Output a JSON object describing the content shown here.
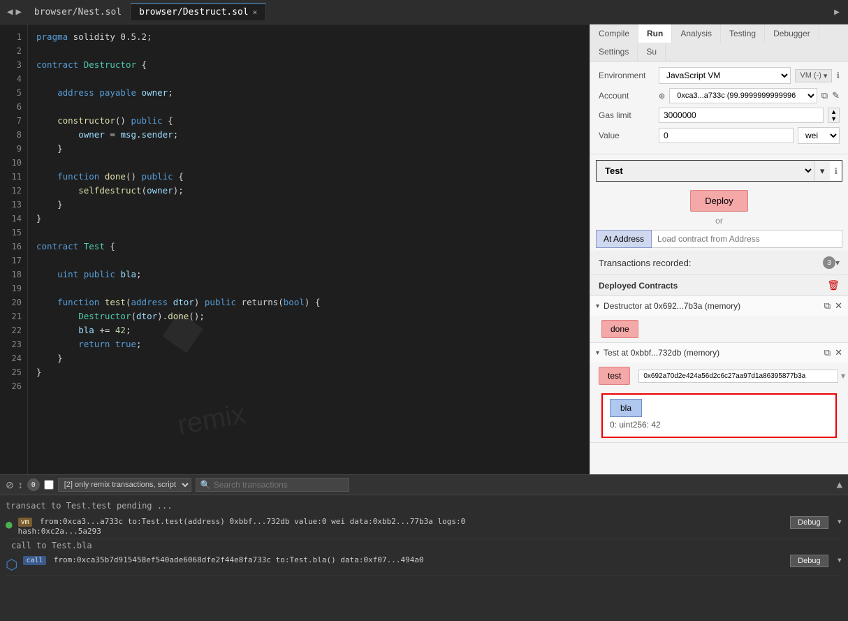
{
  "tabs": [
    {
      "id": "nest",
      "label": "browser/Nest.sol",
      "active": false,
      "closable": false
    },
    {
      "id": "destruct",
      "label": "browser/Destruct.sol",
      "active": true,
      "closable": true
    }
  ],
  "rightPanel": {
    "tabs": [
      "Compile",
      "Run",
      "Analysis",
      "Testing",
      "Debugger",
      "Settings",
      "Su"
    ],
    "activeTab": "Run",
    "environment": {
      "label": "Environment",
      "value": "JavaScript VM",
      "vmBadge": "VM (-)"
    },
    "account": {
      "label": "Account",
      "value": "0xca3...a733c (99.9999999999996"
    },
    "gasLimit": {
      "label": "Gas limit",
      "value": "3000000"
    },
    "value": {
      "label": "Value",
      "amount": "0",
      "unit": "wei"
    },
    "contractSelect": "Test",
    "deployBtn": "Deploy",
    "orText": "or",
    "atAddressBtn": "At Address",
    "atAddressPlaceholder": "Load contract from Address",
    "transactionsRecorded": "Transactions recorded:",
    "transactionsBadge": "3",
    "deployedContracts": "Deployed Contracts",
    "contracts": [
      {
        "id": "destructor",
        "name": "Destructor at 0x692...7b3a (memory)",
        "buttons": [
          "done"
        ]
      },
      {
        "id": "test",
        "name": "Test at 0xbbf...732db (memory)",
        "buttons": [
          "test"
        ],
        "testInput": "0x692a70d2e424a56d2c6c27aa97d1a86395877b3a",
        "extraButtons": [
          "bla"
        ],
        "blaResult": "0: uint256: 42"
      }
    ]
  },
  "code": {
    "lines": [
      {
        "num": 1,
        "text": "pragma solidity 0.5.2;",
        "tokens": [
          {
            "t": "kw",
            "v": "pragma"
          },
          {
            "t": "op",
            "v": " solidity 0.5.2;"
          }
        ]
      },
      {
        "num": 2,
        "text": ""
      },
      {
        "num": 3,
        "text": "contract Destructor {",
        "tokens": [
          {
            "t": "kw",
            "v": "contract"
          },
          {
            "t": "op",
            "v": " "
          },
          {
            "t": "kw2",
            "v": "Destructor"
          },
          {
            "t": "op",
            "v": " {"
          }
        ]
      },
      {
        "num": 4,
        "text": ""
      },
      {
        "num": 5,
        "text": "    address payable owner;",
        "tokens": [
          {
            "t": "kw",
            "v": "    address"
          },
          {
            "t": "op",
            "v": " "
          },
          {
            "t": "kw",
            "v": "payable"
          },
          {
            "t": "op",
            "v": " "
          },
          {
            "t": "param",
            "v": "owner"
          },
          {
            "t": "op",
            "v": ";"
          }
        ]
      },
      {
        "num": 6,
        "text": ""
      },
      {
        "num": 7,
        "text": "    constructor() public {",
        "tokens": [
          {
            "t": "op",
            "v": "    "
          },
          {
            "t": "fn",
            "v": "constructor"
          },
          {
            "t": "op",
            "v": "() "
          },
          {
            "t": "kw",
            "v": "public"
          },
          {
            "t": "op",
            "v": " {"
          }
        ]
      },
      {
        "num": 8,
        "text": "        owner = msg.sender;",
        "tokens": [
          {
            "t": "op",
            "v": "        "
          },
          {
            "t": "param",
            "v": "owner"
          },
          {
            "t": "op",
            "v": " = "
          },
          {
            "t": "param",
            "v": "msg"
          },
          {
            "t": "op",
            "v": "."
          },
          {
            "t": "param",
            "v": "sender"
          },
          {
            "t": "op",
            "v": ";"
          }
        ]
      },
      {
        "num": 9,
        "text": "    }",
        "tokens": [
          {
            "t": "op",
            "v": "    }"
          }
        ]
      },
      {
        "num": 10,
        "text": ""
      },
      {
        "num": 11,
        "text": "    function done() public {",
        "tokens": [
          {
            "t": "op",
            "v": "    "
          },
          {
            "t": "kw",
            "v": "function"
          },
          {
            "t": "op",
            "v": " "
          },
          {
            "t": "fn",
            "v": "done"
          },
          {
            "t": "op",
            "v": "() "
          },
          {
            "t": "kw",
            "v": "public"
          },
          {
            "t": "op",
            "v": " {"
          }
        ]
      },
      {
        "num": 12,
        "text": "        selfdestruct(owner);",
        "tokens": [
          {
            "t": "op",
            "v": "        "
          },
          {
            "t": "fn",
            "v": "selfdestruct"
          },
          {
            "t": "op",
            "v": "("
          },
          {
            "t": "param",
            "v": "owner"
          },
          {
            "t": "op",
            "v": ");"
          }
        ]
      },
      {
        "num": 13,
        "text": "    }",
        "tokens": [
          {
            "t": "op",
            "v": "    }"
          }
        ]
      },
      {
        "num": 14,
        "text": "}"
      },
      {
        "num": 15,
        "text": ""
      },
      {
        "num": 16,
        "text": "contract Test {",
        "tokens": [
          {
            "t": "kw",
            "v": "contract"
          },
          {
            "t": "op",
            "v": " "
          },
          {
            "t": "kw2",
            "v": "Test"
          },
          {
            "t": "op",
            "v": " {"
          }
        ]
      },
      {
        "num": 17,
        "text": ""
      },
      {
        "num": 18,
        "text": "    uint public bla;",
        "tokens": [
          {
            "t": "kw",
            "v": "    uint"
          },
          {
            "t": "op",
            "v": " "
          },
          {
            "t": "kw",
            "v": "public"
          },
          {
            "t": "op",
            "v": " "
          },
          {
            "t": "param",
            "v": "bla"
          },
          {
            "t": "op",
            "v": ";"
          }
        ]
      },
      {
        "num": 19,
        "text": ""
      },
      {
        "num": 20,
        "text": "    function test(address dtor) public returns(bool) {",
        "tokens": [
          {
            "t": "op",
            "v": "    "
          },
          {
            "t": "kw",
            "v": "function"
          },
          {
            "t": "op",
            "v": " "
          },
          {
            "t": "fn",
            "v": "test"
          },
          {
            "t": "op",
            "v": "("
          },
          {
            "t": "kw",
            "v": "address"
          },
          {
            "t": "op",
            "v": " "
          },
          {
            "t": "param",
            "v": "dtor"
          },
          {
            "t": "op",
            "v": ") "
          },
          {
            "t": "kw",
            "v": "public"
          },
          {
            "t": "op",
            "v": " returns("
          },
          {
            "t": "kw",
            "v": "bool"
          },
          {
            "t": "op",
            "v": ") {"
          }
        ]
      },
      {
        "num": 21,
        "text": "        Destructor(dtor).done();",
        "tokens": [
          {
            "t": "op",
            "v": "        "
          },
          {
            "t": "kw2",
            "v": "Destructor"
          },
          {
            "t": "op",
            "v": "("
          },
          {
            "t": "param",
            "v": "dtor"
          },
          {
            "t": "op",
            "v": ")."
          },
          {
            "t": "fn",
            "v": "done"
          },
          {
            "t": "op",
            "v": "();"
          }
        ]
      },
      {
        "num": 22,
        "text": "        bla += 42;",
        "tokens": [
          {
            "t": "op",
            "v": "        "
          },
          {
            "t": "param",
            "v": "bla"
          },
          {
            "t": "op",
            "v": " += "
          },
          {
            "t": "num",
            "v": "42"
          },
          {
            "t": "op",
            "v": ";"
          }
        ]
      },
      {
        "num": 23,
        "text": "        return true;",
        "tokens": [
          {
            "t": "op",
            "v": "        "
          },
          {
            "t": "kw",
            "v": "return"
          },
          {
            "t": "op",
            "v": " "
          },
          {
            "t": "kw",
            "v": "true"
          },
          {
            "t": "op",
            "v": ";"
          }
        ]
      },
      {
        "num": 24,
        "text": "    }",
        "tokens": [
          {
            "t": "op",
            "v": "    }"
          }
        ]
      },
      {
        "num": 25,
        "text": "}",
        "tokens": [
          {
            "t": "op",
            "v": "}"
          }
        ]
      },
      {
        "num": 26,
        "text": ""
      }
    ]
  },
  "bottomPanel": {
    "icons": [
      "clear",
      "scroll",
      "count"
    ],
    "count": "0",
    "checkboxLabel": "",
    "filterOptions": [
      "[2] only remix transactions, script"
    ],
    "searchPlaceholder": "Search transactions",
    "logs": [
      {
        "type": "pending",
        "text": "transact to Test.test pending ..."
      },
      {
        "type": "vm",
        "tag": "vm",
        "from": "from:0xca3...a733c",
        "to": "to:Test.test(address)",
        "addr": "0xbbf...732db",
        "value": "value:0",
        "wei": "wei",
        "data": "data:0xbb2...77b3a",
        "logs": "logs:0",
        "hash": "hash:0xc2a...5a293",
        "hasDebug": true
      },
      {
        "type": "call",
        "tag": "call",
        "text": "call to Test.bla",
        "content": "from:0xca35b7d915458ef540ade6068dfe2f44e8fa733c to:Test.bla() data:0xf07...494a0",
        "hasDebug": true
      }
    ]
  }
}
